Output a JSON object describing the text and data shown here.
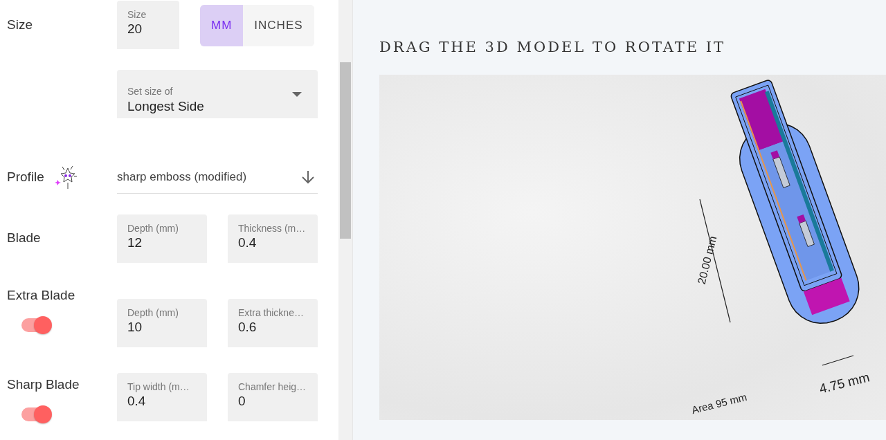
{
  "sidebar": {
    "size": {
      "label": "Size",
      "field": {
        "label": "Size",
        "value": "20"
      },
      "units": [
        {
          "label": "MM",
          "selected": true
        },
        {
          "label": "INCHES",
          "selected": false
        }
      ],
      "set_size_of": {
        "label": "Set size of",
        "value": "Longest Side"
      }
    },
    "profile": {
      "label": "Profile",
      "value": "sharp emboss (modified)"
    },
    "sections": [
      {
        "label": "Blade",
        "fields": [
          {
            "label": "Depth (mm)",
            "value": "12"
          },
          {
            "label": "Thickness (m…",
            "value": "0.4"
          }
        ]
      },
      {
        "label": "Extra Blade",
        "on": true,
        "fields": [
          {
            "label": "Depth (mm)",
            "value": "10"
          },
          {
            "label": "Extra thickne…",
            "value": "0.6"
          }
        ]
      },
      {
        "label": "Sharp Blade",
        "on": true,
        "fields": [
          {
            "label": "Tip width (m…",
            "value": "0.4"
          },
          {
            "label": "Chamfer heig…",
            "value": "0"
          }
        ]
      }
    ]
  },
  "viewer": {
    "title": "DRAG THE 3D MODEL TO ROTATE IT",
    "measurements": [
      {
        "kind": "height",
        "text": "20.00 mm"
      },
      {
        "kind": "width",
        "text": "4.75 mm"
      },
      {
        "kind": "area",
        "text": "Area 95 mm"
      }
    ]
  }
}
